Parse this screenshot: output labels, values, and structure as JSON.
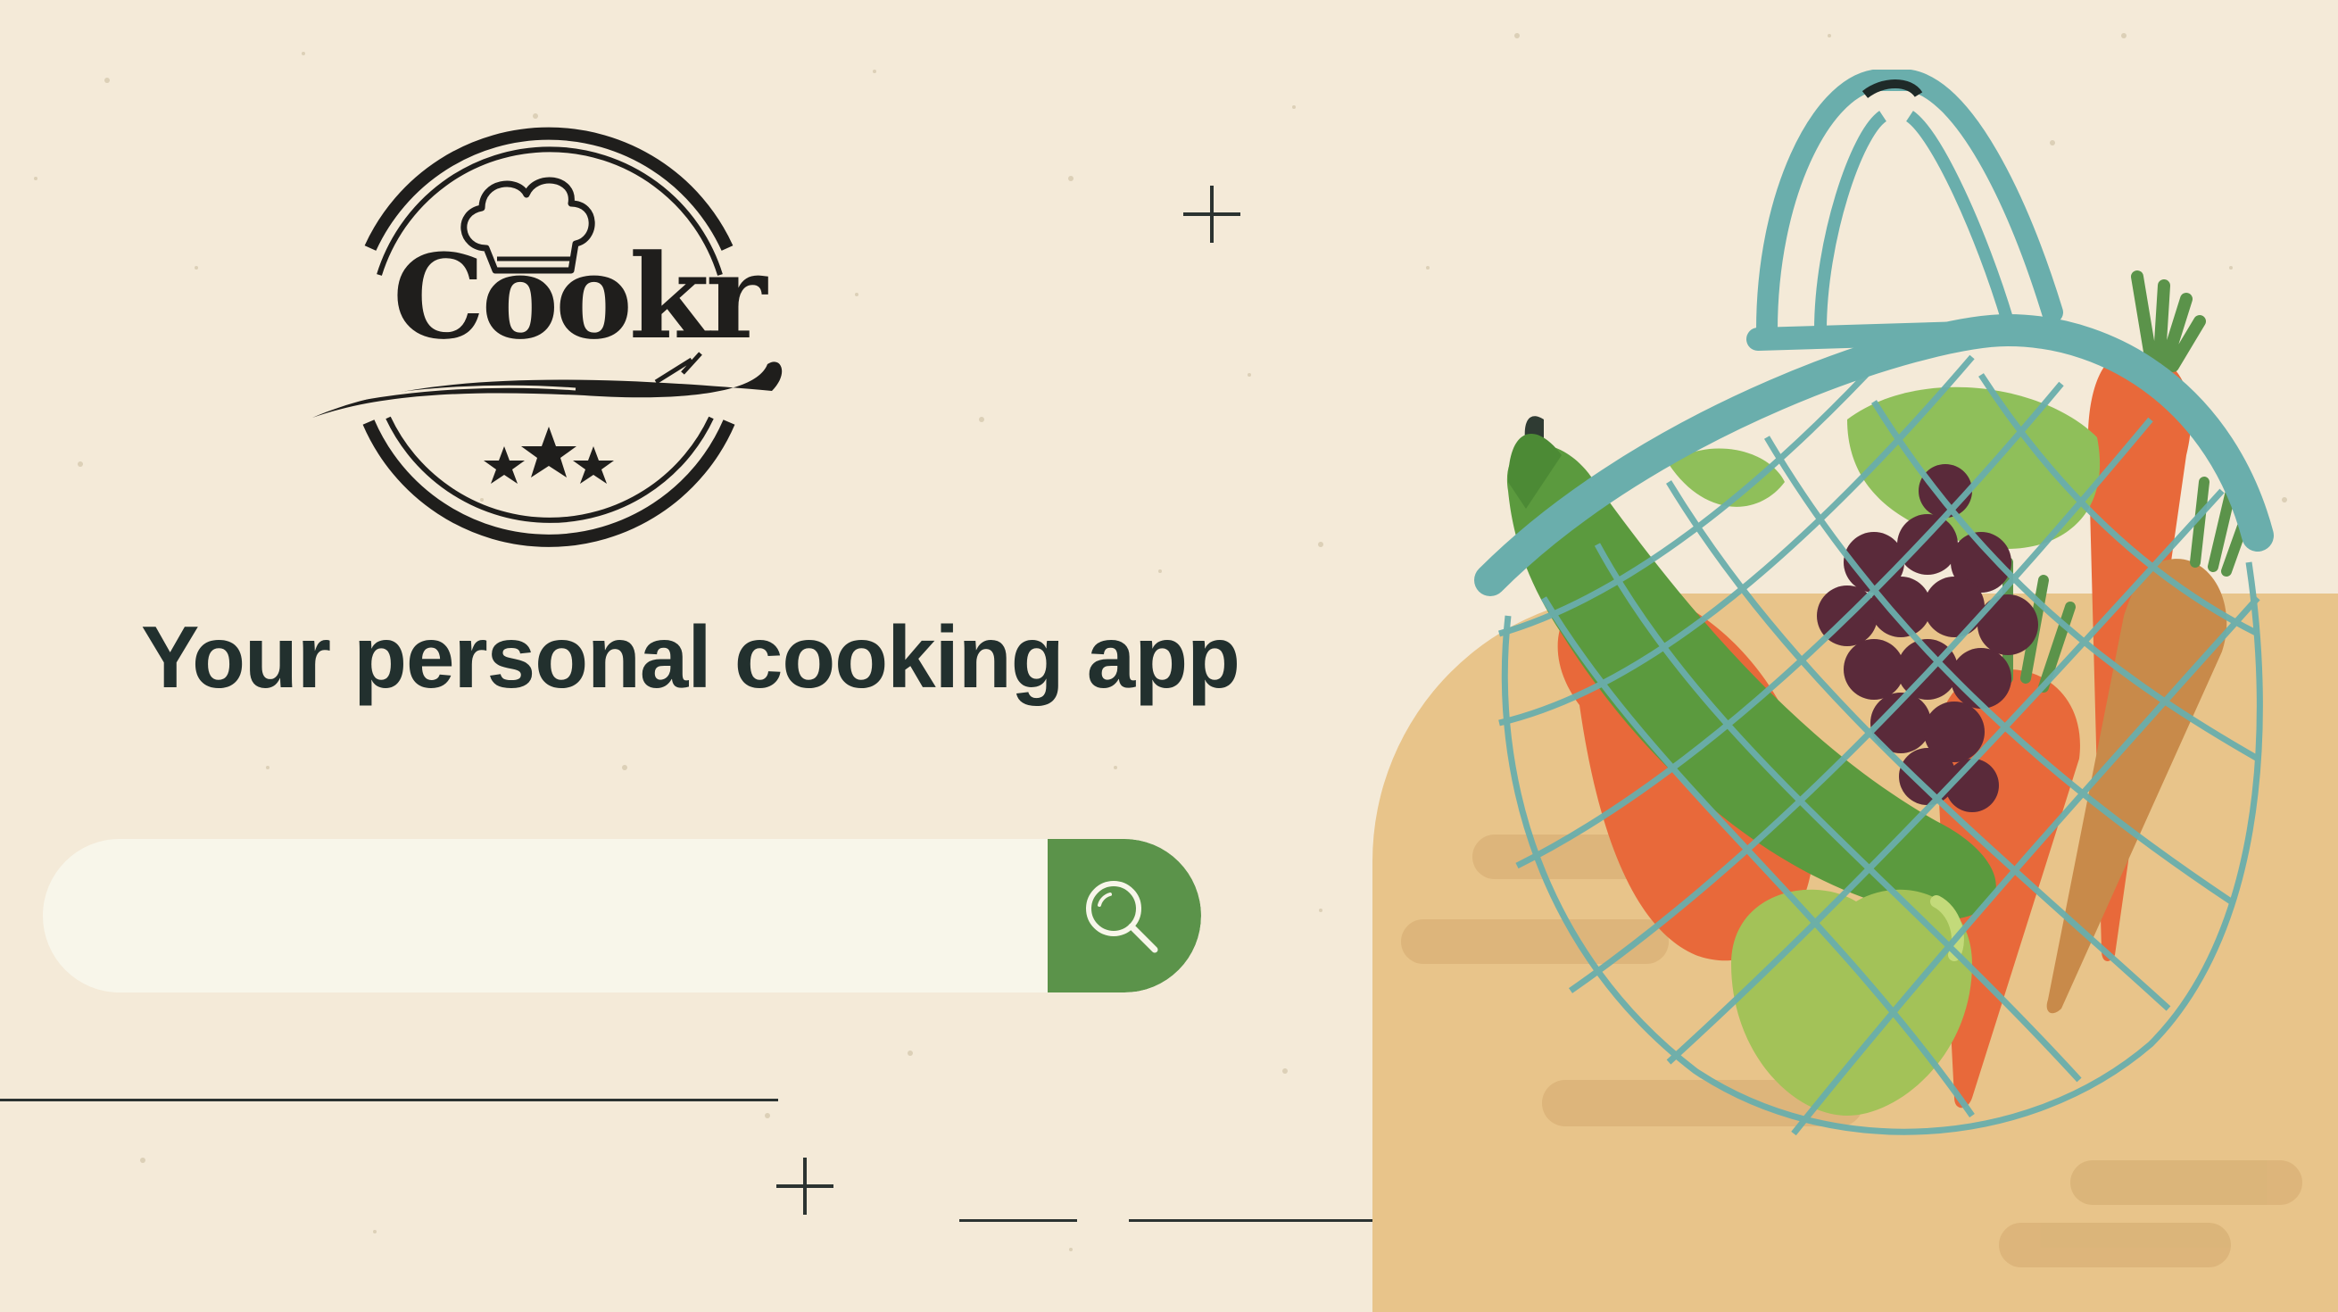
{
  "app": {
    "brand_name": "Cookr",
    "tagline": "Your personal cooking app"
  },
  "search": {
    "value": "",
    "placeholder": "",
    "button_icon": "search-icon"
  },
  "icons": {
    "logo": "chef-hat-logo",
    "illustration": "vegetable-net-bag-illustration"
  },
  "colors": {
    "background": "#f4ead8",
    "accent_green": "#5b934a",
    "search_field": "#f8f6ea",
    "text_dark": "#22302e",
    "table": "#e8c48a",
    "net": "#6aaeac"
  }
}
